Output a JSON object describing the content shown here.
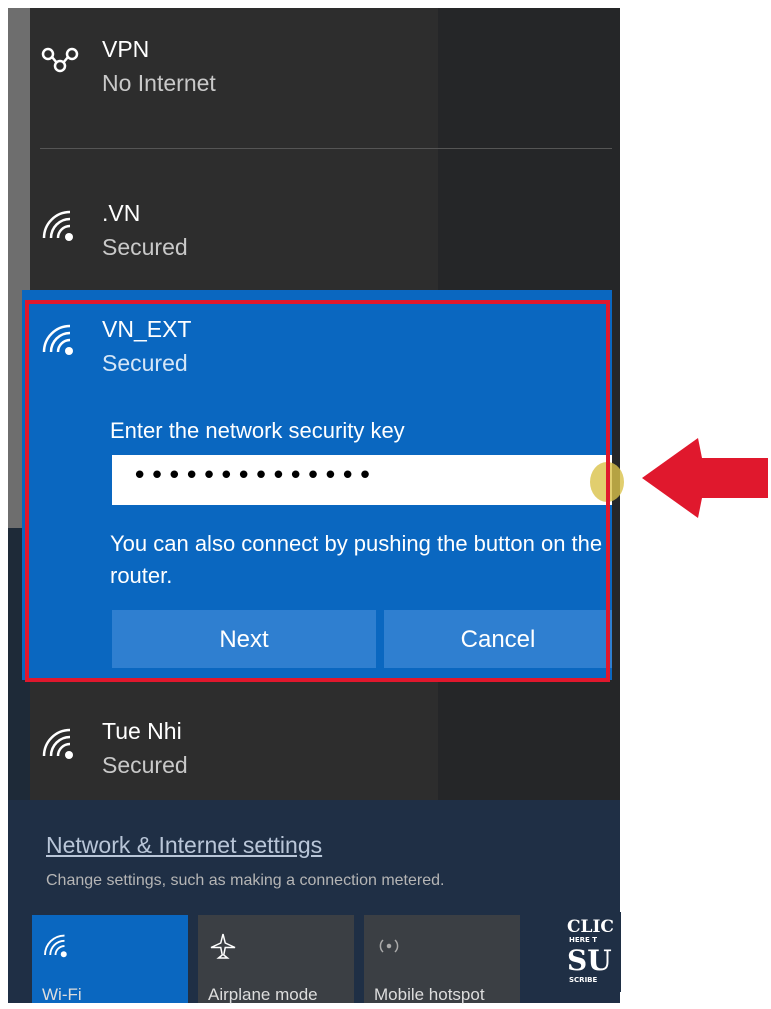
{
  "networks": {
    "vpn": {
      "name": "VPN",
      "status": "No Internet",
      "icon": "vpn-icon"
    },
    "vn": {
      "name": ".VN",
      "status": "Secured",
      "icon": "wifi-icon"
    },
    "vn_ext": {
      "name": "VN_EXT",
      "status": "Secured",
      "icon": "wifi-icon"
    },
    "tue_nhi": {
      "name": "Tue Nhi",
      "status": "Secured",
      "icon": "wifi-icon"
    }
  },
  "connect_form": {
    "prompt": "Enter the network security key",
    "password_value": "••••••••••••••",
    "helper": "You can also connect by pushing the button on the router.",
    "next_label": "Next",
    "cancel_label": "Cancel"
  },
  "settings": {
    "link": "Network & Internet settings",
    "description": "Change settings, such as making a connection metered."
  },
  "quick_actions": [
    {
      "label": "Wi-Fi",
      "icon": "wifi-icon",
      "active": true
    },
    {
      "label": "Airplane mode",
      "icon": "airplane-icon",
      "active": false
    },
    {
      "label": "Mobile hotspot",
      "icon": "hotspot-icon",
      "active": false
    }
  ],
  "colors": {
    "accent": "#0a67c0",
    "highlight_outline": "#e0182d",
    "arrow": "#e0182d",
    "panel": "#2d2d2d"
  }
}
